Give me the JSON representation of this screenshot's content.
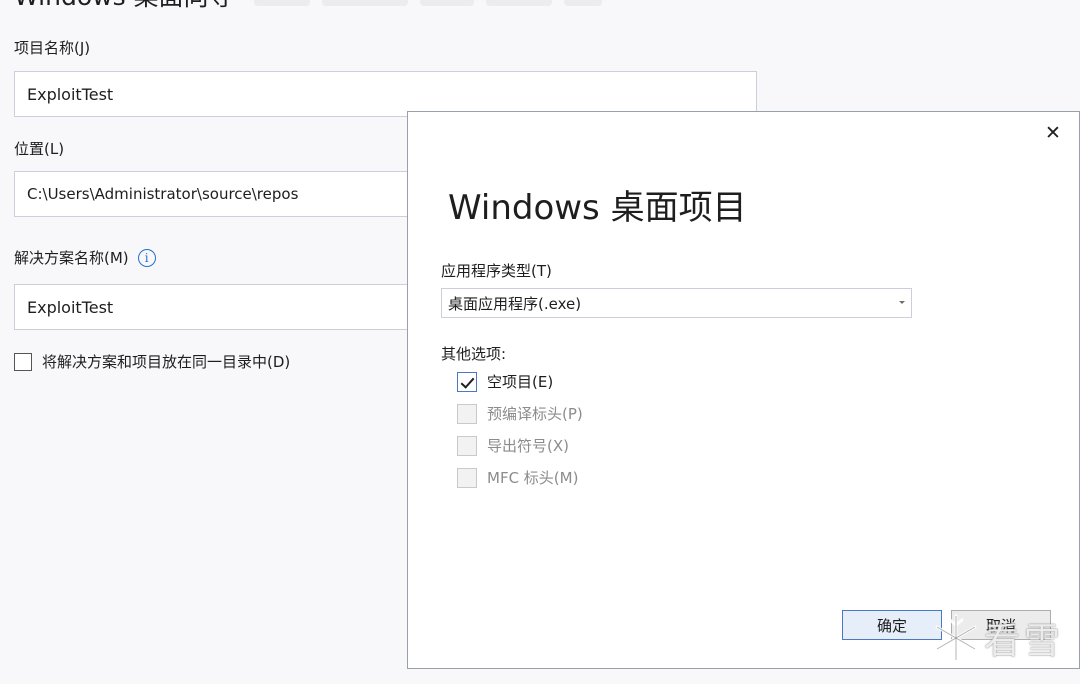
{
  "background": {
    "title": "Windows 桌面向导",
    "project_name_label": "项目名称(J)",
    "project_name_value": "ExploitTest",
    "location_label": "位置(L)",
    "location_value": "C:\\Users\\Administrator\\source\\repos",
    "solution_name_label": "解决方案名称(M)",
    "solution_name_value": "ExploitTest",
    "same_dir_checkbox_label": "将解决方案和项目放在同一目录中(D)",
    "same_dir_checked": false
  },
  "dialog": {
    "title": "Windows 桌面项目",
    "app_type_label": "应用程序类型(T)",
    "app_type_selected": "桌面应用程序(.exe)",
    "other_options_label": "其他选项:",
    "options": [
      {
        "label": "空项目(E)",
        "checked": true,
        "enabled": true
      },
      {
        "label": "预编译标头(P)",
        "checked": false,
        "enabled": false
      },
      {
        "label": "导出符号(X)",
        "checked": false,
        "enabled": false
      },
      {
        "label": "MFC 标头(M)",
        "checked": false,
        "enabled": false
      }
    ],
    "ok_label": "确定",
    "cancel_label": "取消"
  },
  "watermark": {
    "text": "看雪"
  },
  "icons": {
    "close": "close-icon",
    "info": "info-icon",
    "dropdown": "chevron-down-icon",
    "check": "checkmark-icon",
    "watermark": "snowflake-icon"
  },
  "colors": {
    "accent": "#1e72d4",
    "button_ok_border": "#4a78c2",
    "disabled_text": "#8c8c8c"
  }
}
